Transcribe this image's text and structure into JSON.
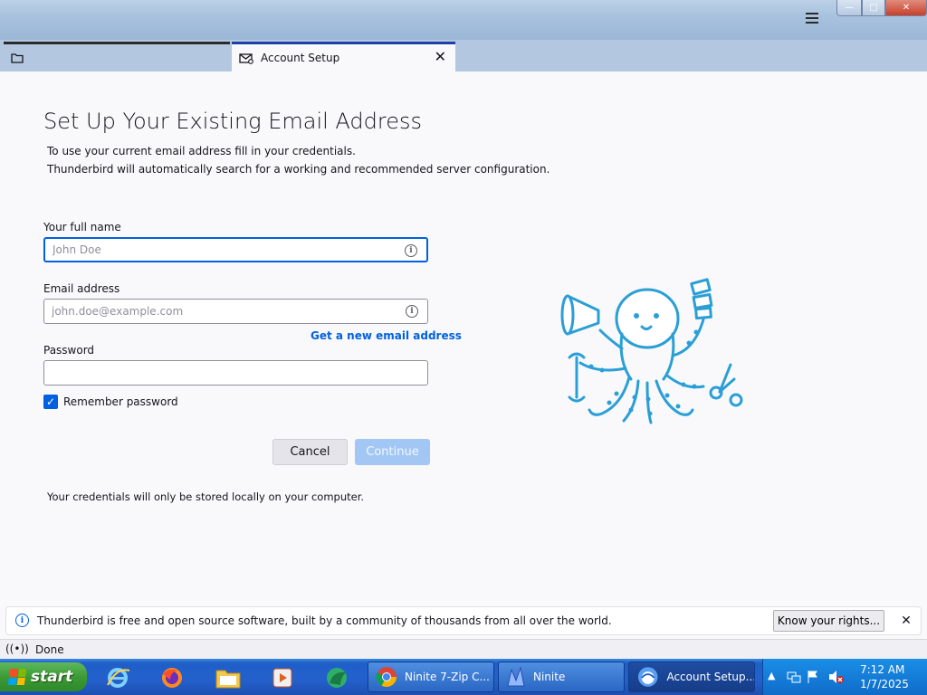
{
  "window": {
    "tab_label": "Account Setup",
    "tab_close": "✕",
    "minimize": "—",
    "maximize": "□",
    "close": "✕"
  },
  "setup": {
    "title": "Set Up Your Existing Email Address",
    "intro_line1": "To use your current email address fill in your credentials.",
    "intro_line2": "Thunderbird will automatically search for a working and recommended server configuration.",
    "full_name_label": "Your full name",
    "full_name_placeholder": "John Doe",
    "full_name_value": "",
    "email_label": "Email address",
    "email_placeholder": "john.doe@example.com",
    "email_value": "",
    "get_new_email": "Get a new email address",
    "password_label": "Password",
    "password_value": "",
    "remember_label": "Remember password",
    "remember_checked": true,
    "cancel_label": "Cancel",
    "continue_label": "Continue",
    "footnote": "Your credentials will only be stored locally on your computer."
  },
  "notification": {
    "text": "Thunderbird is free and open source software, built by a community of thousands from all over the world.",
    "button": "Know your rights...",
    "close": "✕"
  },
  "status": {
    "text": "Done"
  },
  "taskbar": {
    "start_label": "start",
    "tasks": [
      {
        "label": "Ninite 7-Zip C..."
      },
      {
        "label": "Ninite"
      },
      {
        "label": "Account Setup..."
      }
    ],
    "tray_arrow": "▲",
    "clock_time": "7:12 AM",
    "clock_date": "1/7/2025"
  },
  "colors": {
    "accent": "#0061e0",
    "continue_disabled": "#a2c7f5",
    "mascot_stroke": "#2a9fd6"
  }
}
